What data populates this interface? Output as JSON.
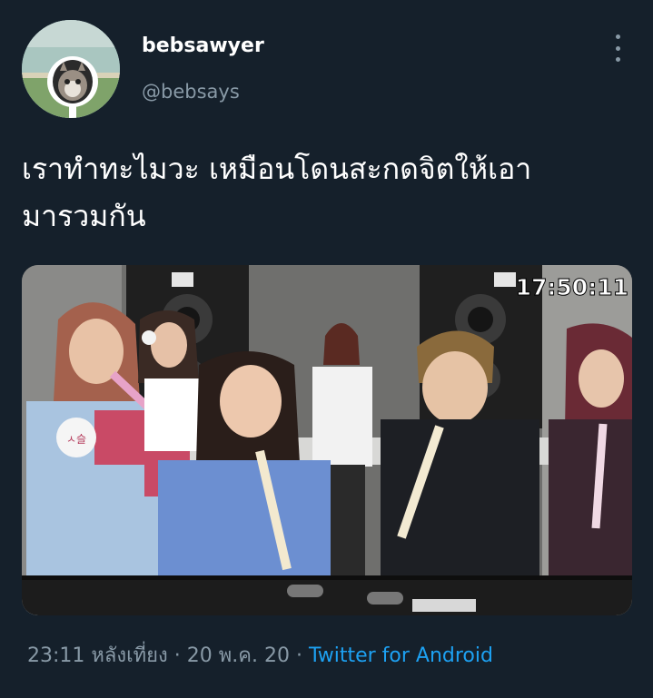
{
  "user": {
    "display_name": "bebsawyer",
    "handle": "@bebsays"
  },
  "tweet": {
    "text_line1": "เราทำทะไมวะ เหมือนโดนสะกดจิตให้เอา",
    "text_line2": "มารวมกัน"
  },
  "media": {
    "timer": "17:50:11",
    "name_tag": "ㅅ슬"
  },
  "meta": {
    "time": "23:11 หลังเที่ยง",
    "separator": " · ",
    "date": "20 พ.ค. 20",
    "source": "Twitter for Android"
  },
  "colors": {
    "background": "#15202b",
    "secondary_text": "#8899a6",
    "link": "#1da1f2"
  },
  "icons": {
    "more": "more-vertical-icon"
  }
}
